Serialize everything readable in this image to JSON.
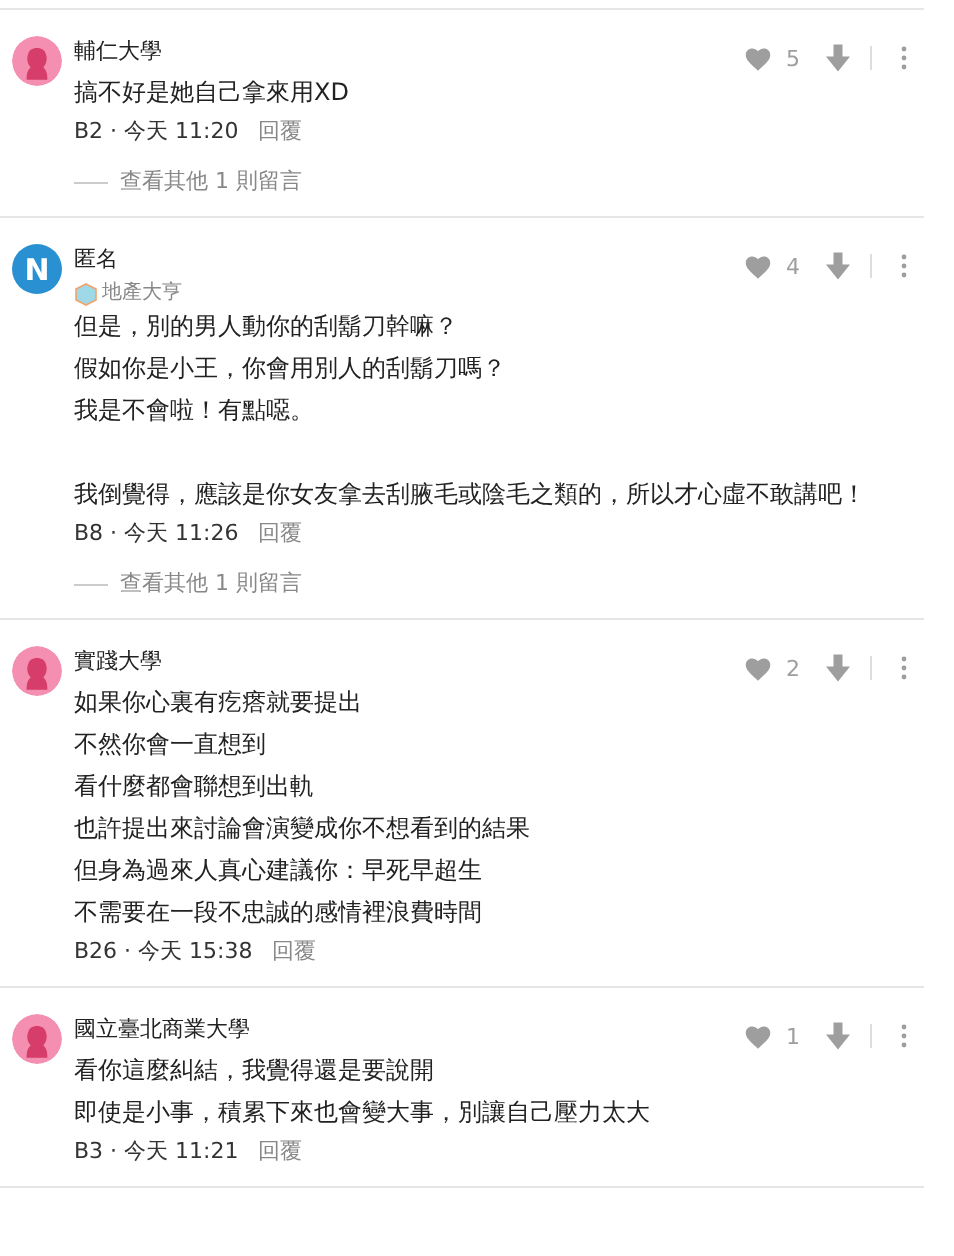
{
  "comments": [
    {
      "avatar": {
        "kind": "female"
      },
      "author": "輔仁大學",
      "likes": "5",
      "paragraphs": [
        [
          "搞不好是她自己拿來用XD"
        ]
      ],
      "meta": "B2 · 今天 11:20",
      "reply": "回覆",
      "more_replies": "查看其他 1 則留言"
    },
    {
      "avatar": {
        "kind": "letter",
        "letter": "N"
      },
      "author": "匿名",
      "badge": "地產大亨",
      "likes": "4",
      "paragraphs": [
        [
          "但是，別的男人動你的刮鬍刀幹嘛？",
          "假如你是小王，你會用別人的刮鬍刀嗎？",
          "我是不會啦！有點噁。"
        ],
        [
          "我倒覺得，應該是你女友拿去刮腋毛或陰毛之類的，所以才心虛不敢講吧！"
        ]
      ],
      "meta": "B8 · 今天 11:26",
      "reply": "回覆",
      "more_replies": "查看其他 1 則留言"
    },
    {
      "avatar": {
        "kind": "female"
      },
      "author": "實踐大學",
      "likes": "2",
      "paragraphs": [
        [
          "如果你心裏有疙瘩就要提出",
          "不然你會一直想到",
          "看什麼都會聯想到出軌",
          "也許提出來討論會演變成你不想看到的結果",
          "但身為過來人真心建議你：早死早超生",
          "不需要在一段不忠誠的感情裡浪費時間"
        ]
      ],
      "meta": "B26 · 今天 15:38",
      "reply": "回覆"
    },
    {
      "avatar": {
        "kind": "female"
      },
      "author": "國立臺北商業大學",
      "likes": "1",
      "paragraphs": [
        [
          "看你這麼糾結，我覺得還是要說開",
          "即使是小事，積累下來也會變大事，別讓自己壓力太大"
        ]
      ],
      "meta": "B3 · 今天 11:21",
      "reply": "回覆"
    }
  ]
}
